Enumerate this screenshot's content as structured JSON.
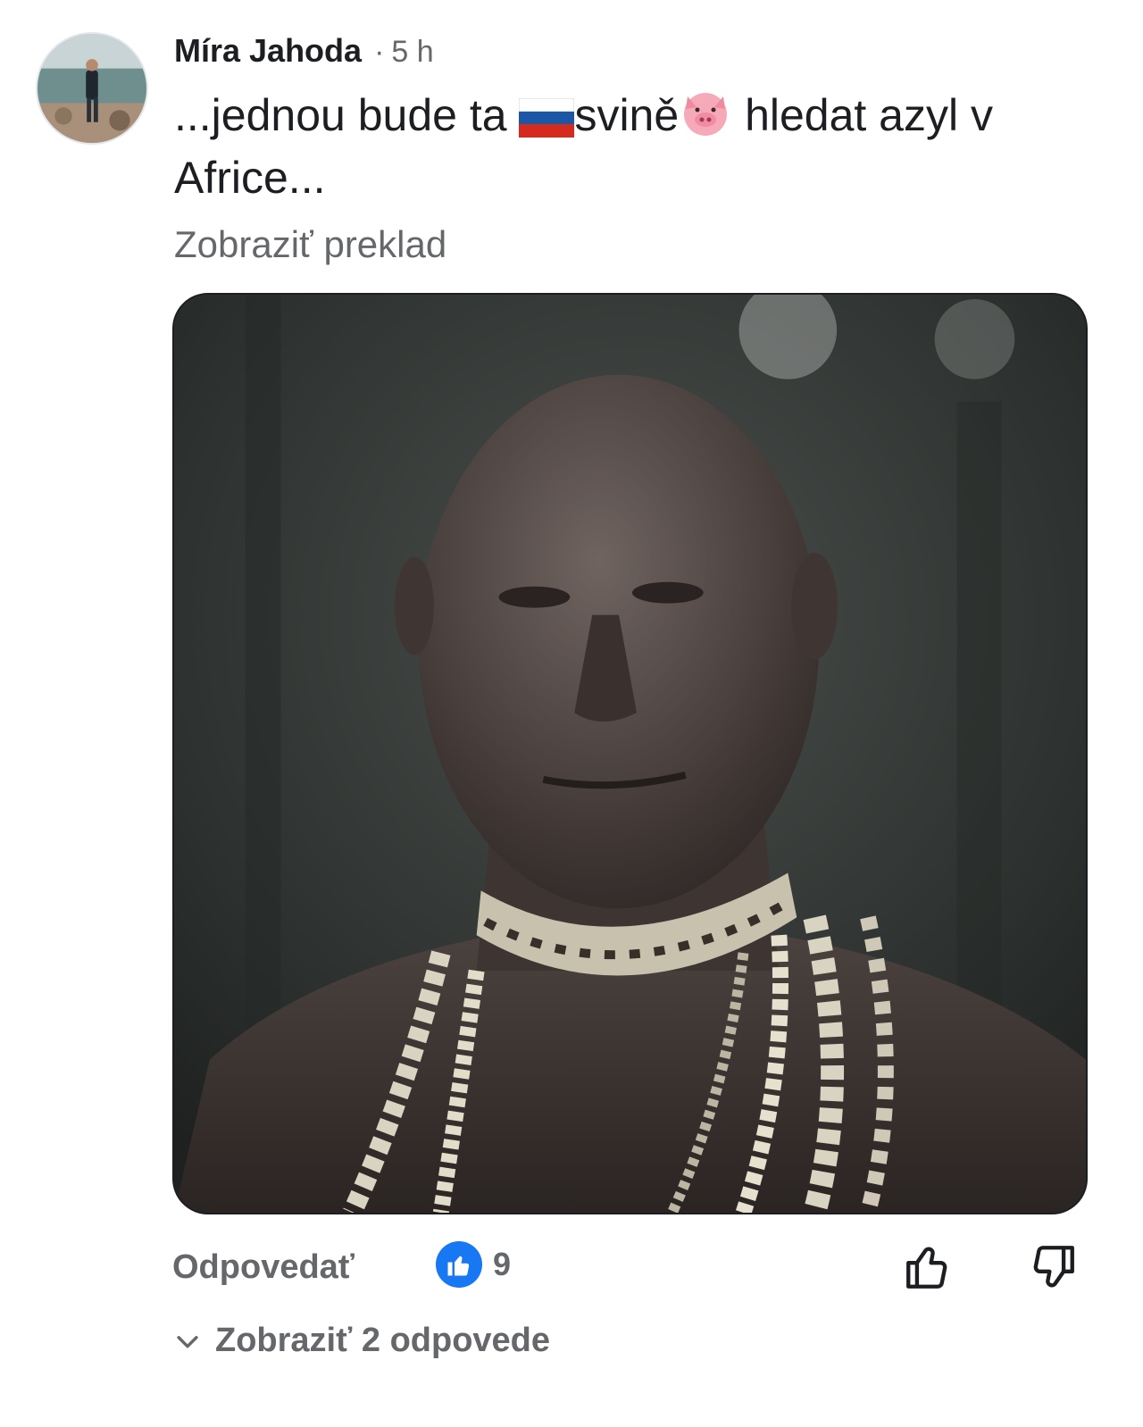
{
  "comment": {
    "author": "Míra Jahoda",
    "time": "5 h",
    "text_part1": "...jednou bude ta ",
    "text_part2": "svině",
    "text_part3": " hledat azyl v Africe...",
    "flag_emoji": "russia-flag-icon",
    "pig_emoji": "pig-face-icon",
    "translate_label": "Zobraziť preklad"
  },
  "actions": {
    "reply_label": "Odpovedať",
    "like_count": "9",
    "view_replies_label": "Zobraziť 2 odpovede"
  },
  "colors": {
    "like_blue": "#1877f2",
    "secondary_text": "#65676b",
    "primary_text": "#1c1e21"
  }
}
